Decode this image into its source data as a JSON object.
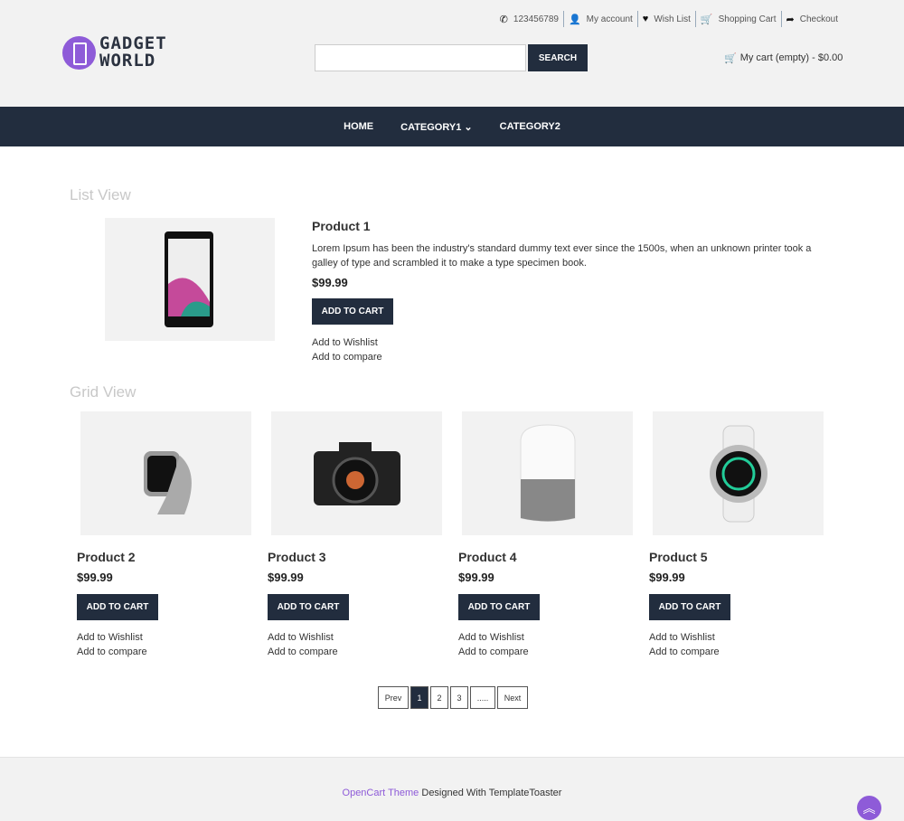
{
  "header": {
    "phone": "123456789",
    "links": [
      "My account",
      "Wish List",
      "Shopping Cart",
      "Checkout"
    ],
    "logo": "GADGET WORLD",
    "logo_line1": "GADGET",
    "logo_line2": "WORLD",
    "search_placeholder": "",
    "search_label": "SEARCH",
    "cart": "My cart (empty) - $0.00"
  },
  "nav": [
    "HOME",
    "CATEGORY1",
    "CATEGORY2"
  ],
  "list_view": {
    "title": "List View",
    "product": {
      "name": "Product 1",
      "desc": "Lorem Ipsum has been the industry's standard dummy text ever since the 1500s, when an unknown printer took a galley of type and scrambled it to make a type specimen book.",
      "price": "$99.99",
      "add": "ADD TO CART",
      "wishlist": "Add to Wishlist",
      "compare": "Add to compare"
    }
  },
  "grid_view": {
    "title": "Grid View",
    "products": [
      {
        "name": "Product 2",
        "price": "$99.99",
        "add": "ADD TO CART",
        "wishlist": "Add to Wishlist",
        "compare": "Add to compare",
        "icon": "watch"
      },
      {
        "name": "Product 3",
        "price": "$99.99",
        "add": "ADD TO CART",
        "wishlist": "Add to Wishlist",
        "compare": "Add to compare",
        "icon": "camera"
      },
      {
        "name": "Product 4",
        "price": "$99.99",
        "add": "ADD TO CART",
        "wishlist": "Add to Wishlist",
        "compare": "Add to compare",
        "icon": "smart-speaker"
      },
      {
        "name": "Product 5",
        "price": "$99.99",
        "add": "ADD TO CART",
        "wishlist": "Add to Wishlist",
        "compare": "Add to compare",
        "icon": "smartwatch"
      }
    ]
  },
  "pagination": {
    "prev": "Prev",
    "pages": [
      "1",
      "2",
      "3",
      "....."
    ],
    "next": "Next",
    "current": "1"
  },
  "footer": {
    "link": "OpenCart Theme",
    "text": " Designed With TemplateToaster"
  },
  "colors": {
    "accent": "#8e5bd8",
    "dark": "#222d3e"
  }
}
